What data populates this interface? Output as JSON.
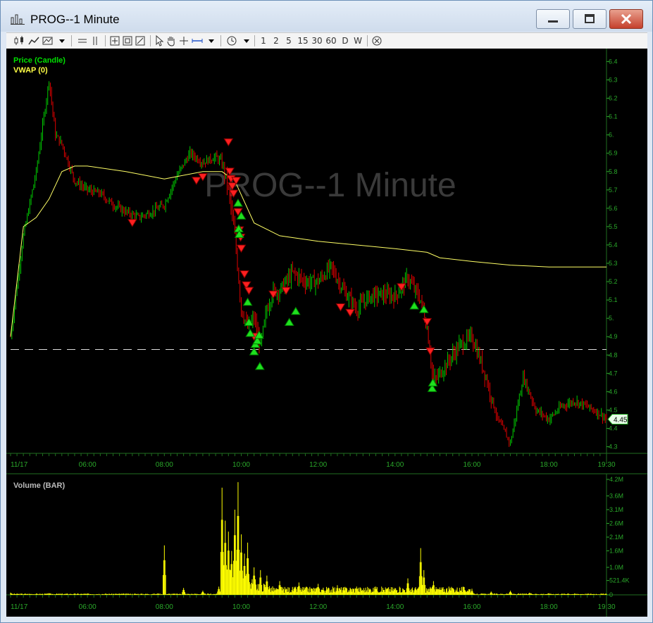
{
  "window": {
    "title": "PROG--1 Minute",
    "buttons": {
      "minimize": "minimize",
      "maximize": "maximize",
      "close": "close"
    }
  },
  "toolbar": {
    "timeframes": [
      "1",
      "2",
      "5",
      "15",
      "30",
      "60",
      "D",
      "W"
    ],
    "icons": [
      "candle-chart-icon",
      "line-chart-icon",
      "chart-style-icon",
      "dropdown-icon",
      "horizontal-line-icon",
      "vertical-line-icon",
      "zoom-fit-icon",
      "zoom-in-icon",
      "zoom-out-icon",
      "pointer-icon",
      "hand-icon",
      "crosshair-icon",
      "measure-icon",
      "dropdown-icon",
      "clock-icon",
      "dropdown-icon",
      "close-circle-icon"
    ]
  },
  "colors": {
    "background": "#000000",
    "up_candle": "#00c800",
    "down_candle": "#e00000",
    "vwap": "#ffff66",
    "volume": "#ffff00",
    "axis_text": "#2aa82a",
    "watermark": "#3a3a3a"
  },
  "chart_data": [
    {
      "type": "line",
      "panel": "price",
      "watermark": "PROG--1 Minute",
      "legend": [
        "Price (Candle)",
        "VWAP (0)"
      ],
      "legend_placement": "top-left",
      "yticks": [
        "6.4",
        "6.3",
        "6.2",
        "6.1",
        "6.",
        "5.9",
        "5.8",
        "5.7",
        "5.6",
        "5.5",
        "5.4",
        "5.3",
        "5.2",
        "5.1",
        "5.",
        "4.9",
        "4.8",
        "4.7",
        "4.6",
        "4.5",
        "4.4",
        "4.3"
      ],
      "ylim": [
        4.26,
        6.44
      ],
      "xlim": [
        "04:00",
        "19:30"
      ],
      "xticks": [
        "11/17",
        "06:00",
        "08:00",
        "10:00",
        "12:00",
        "14:00",
        "16:00",
        "18:00",
        "19:30"
      ],
      "last_price_label": "4.45",
      "reference_line": 4.83,
      "series": [
        {
          "name": "Price (Candle)",
          "x": [
            "04:00",
            "04:20",
            "04:40",
            "05:00",
            "05:10",
            "05:20",
            "05:40",
            "06:00",
            "06:20",
            "06:40",
            "07:00",
            "07:20",
            "07:40",
            "08:00",
            "08:20",
            "08:40",
            "09:00",
            "09:20",
            "09:30",
            "09:40",
            "09:50",
            "10:00",
            "10:10",
            "10:20",
            "10:30",
            "10:40",
            "10:50",
            "11:00",
            "11:20",
            "11:40",
            "12:00",
            "12:20",
            "12:40",
            "13:00",
            "13:20",
            "13:40",
            "14:00",
            "14:20",
            "14:40",
            "14:50",
            "15:00",
            "15:20",
            "15:40",
            "16:00",
            "16:20",
            "16:40",
            "17:00",
            "17:20",
            "17:40",
            "18:00",
            "18:20",
            "18:40",
            "19:00",
            "19:20",
            "19:30"
          ],
          "values": [
            4.9,
            5.45,
            5.8,
            6.3,
            6.0,
            5.95,
            5.75,
            5.7,
            5.68,
            5.62,
            5.58,
            5.55,
            5.58,
            5.62,
            5.78,
            5.9,
            5.85,
            5.88,
            5.85,
            5.7,
            5.45,
            5.05,
            4.95,
            5.0,
            4.85,
            5.05,
            5.15,
            5.15,
            5.25,
            5.2,
            5.2,
            5.28,
            5.15,
            5.05,
            5.12,
            5.13,
            5.12,
            5.22,
            5.1,
            4.95,
            4.65,
            4.75,
            4.85,
            4.9,
            4.7,
            4.45,
            4.32,
            4.68,
            4.5,
            4.45,
            4.52,
            4.55,
            4.52,
            4.48,
            4.45
          ]
        },
        {
          "name": "VWAP (0)",
          "x": [
            "04:00",
            "04:20",
            "04:40",
            "05:00",
            "05:20",
            "05:40",
            "06:00",
            "07:00",
            "08:00",
            "09:00",
            "09:30",
            "09:50",
            "10:20",
            "11:00",
            "12:00",
            "13:00",
            "14:00",
            "14:50",
            "15:10",
            "16:00",
            "17:00",
            "18:00",
            "19:30"
          ],
          "values": [
            4.9,
            5.5,
            5.55,
            5.65,
            5.8,
            5.83,
            5.83,
            5.8,
            5.76,
            5.8,
            5.8,
            5.75,
            5.52,
            5.45,
            5.42,
            5.4,
            5.38,
            5.36,
            5.33,
            5.31,
            5.29,
            5.28,
            5.28
          ]
        }
      ],
      "markers": {
        "sell_down_arrows": [
          {
            "x": "07:10",
            "y": 5.52
          },
          {
            "x": "08:50",
            "y": 5.75
          },
          {
            "x": "09:00",
            "y": 5.77
          },
          {
            "x": "09:40",
            "y": 5.96
          },
          {
            "x": "09:42",
            "y": 5.8
          },
          {
            "x": "09:44",
            "y": 5.76
          },
          {
            "x": "09:46",
            "y": 5.72
          },
          {
            "x": "09:48",
            "y": 5.68
          },
          {
            "x": "09:52",
            "y": 5.75
          },
          {
            "x": "09:55",
            "y": 5.58
          },
          {
            "x": "09:57",
            "y": 5.48
          },
          {
            "x": "09:59",
            "y": 5.44
          },
          {
            "x": "10:00",
            "y": 5.38
          },
          {
            "x": "10:05",
            "y": 5.24
          },
          {
            "x": "10:08",
            "y": 5.18
          },
          {
            "x": "10:12",
            "y": 5.15
          },
          {
            "x": "10:20",
            "y": 4.9
          },
          {
            "x": "10:50",
            "y": 5.13
          },
          {
            "x": "11:10",
            "y": 5.15
          },
          {
            "x": "12:35",
            "y": 5.06
          },
          {
            "x": "12:50",
            "y": 5.03
          },
          {
            "x": "14:10",
            "y": 5.17
          },
          {
            "x": "14:50",
            "y": 4.98
          },
          {
            "x": "14:55",
            "y": 4.82
          }
        ],
        "buy_up_arrows": [
          {
            "x": "09:55",
            "y": 5.63
          },
          {
            "x": "09:56",
            "y": 5.49
          },
          {
            "x": "09:57",
            "y": 5.46
          },
          {
            "x": "10:00",
            "y": 5.56
          },
          {
            "x": "10:10",
            "y": 5.09
          },
          {
            "x": "10:12",
            "y": 4.98
          },
          {
            "x": "10:14",
            "y": 4.92
          },
          {
            "x": "10:20",
            "y": 4.82
          },
          {
            "x": "10:22",
            "y": 4.86
          },
          {
            "x": "10:25",
            "y": 4.88
          },
          {
            "x": "10:28",
            "y": 4.91
          },
          {
            "x": "10:29",
            "y": 4.74
          },
          {
            "x": "11:15",
            "y": 4.98
          },
          {
            "x": "11:25",
            "y": 5.04
          },
          {
            "x": "14:30",
            "y": 5.07
          },
          {
            "x": "14:45",
            "y": 5.05
          },
          {
            "x": "14:58",
            "y": 4.62
          },
          {
            "x": "14:59",
            "y": 4.65
          }
        ]
      }
    },
    {
      "type": "bar",
      "panel": "volume",
      "legend": [
        "Volume (BAR)"
      ],
      "yticks": [
        "4.2M",
        "3.6M",
        "3.1M",
        "2.6M",
        "2.1M",
        "1.6M",
        "1.0M",
        "521.4K",
        "0"
      ],
      "ylim": [
        0,
        4200000
      ],
      "xticks": [
        "11/17",
        "06:00",
        "08:00",
        "10:00",
        "12:00",
        "14:00",
        "16:00",
        "18:00",
        "19:30"
      ],
      "series": [
        {
          "name": "Volume (BAR)",
          "x": [
            "04:00",
            "05:00",
            "06:00",
            "07:00",
            "07:50",
            "08:00",
            "08:30",
            "09:00",
            "09:25",
            "09:30",
            "09:35",
            "09:40",
            "09:45",
            "09:50",
            "09:55",
            "10:00",
            "10:05",
            "10:10",
            "10:20",
            "10:30",
            "10:40",
            "11:00",
            "11:30",
            "12:00",
            "12:30",
            "13:00",
            "13:30",
            "14:00",
            "14:20",
            "14:40",
            "14:45",
            "15:00",
            "15:30",
            "16:00",
            "16:30",
            "17:00",
            "17:30",
            "18:00",
            "18:30",
            "19:00",
            "19:30"
          ],
          "values": [
            80000,
            60000,
            50000,
            40000,
            50000,
            1800000,
            250000,
            150000,
            300000,
            3900000,
            2700000,
            2300000,
            1600000,
            3100000,
            4100000,
            2200000,
            1500000,
            1900000,
            1000000,
            900000,
            700000,
            500000,
            450000,
            400000,
            350000,
            300000,
            300000,
            250000,
            600000,
            1700000,
            900000,
            500000,
            250000,
            200000,
            120000,
            150000,
            80000,
            60000,
            50000,
            40000,
            30000
          ]
        }
      ]
    }
  ]
}
